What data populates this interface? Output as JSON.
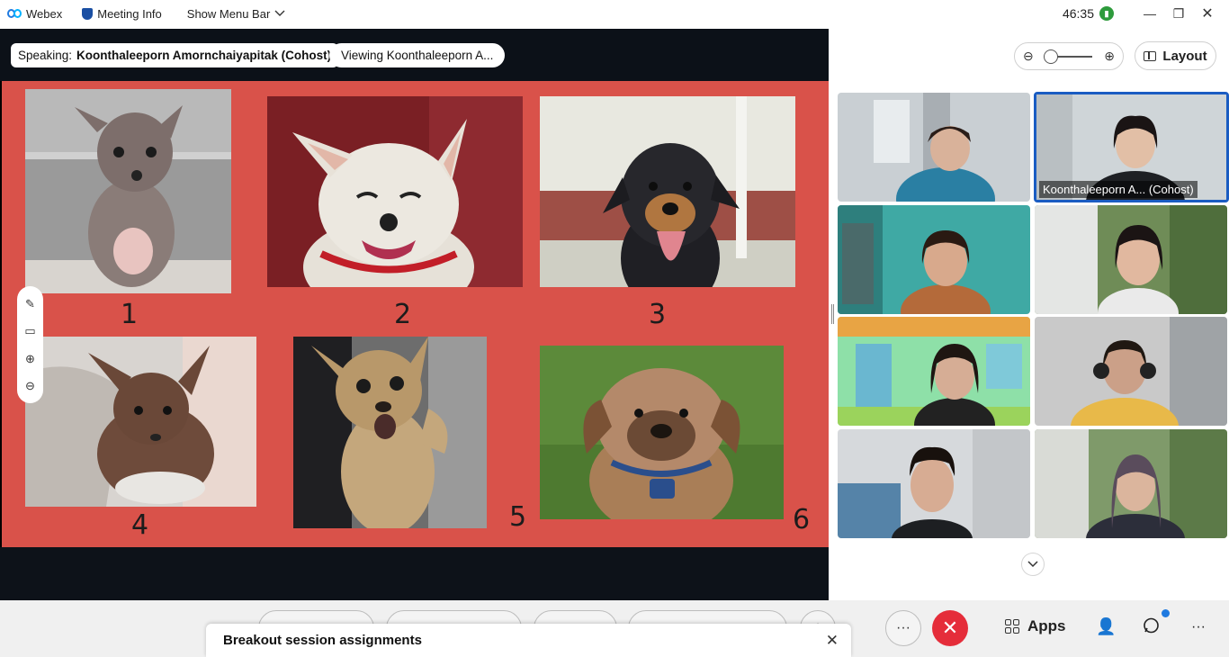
{
  "titlebar": {
    "app_name": "Webex",
    "meeting_info": "Meeting Info",
    "show_menu_bar": "Show Menu Bar",
    "timer": "46:35",
    "window_controls": {
      "minimize": "—",
      "restore": "❐",
      "close": "✕"
    }
  },
  "share": {
    "speaking_label": "Speaking:",
    "speaking_name": "Koonthaleeporn Amornchaiyapitak (Cohost)",
    "viewing_label": "Viewing Koonthaleeporn A...",
    "dog_numbers": [
      "1",
      "2",
      "3",
      "4",
      "5",
      "6"
    ],
    "annotation_tools": [
      "pen-icon",
      "screen-icon",
      "zoom-in-icon",
      "zoom-out-icon"
    ]
  },
  "panel": {
    "layout_label": "Layout",
    "zoom_level": 0.0,
    "participants": [
      {
        "name": ""
      },
      {
        "name": "Koonthaleeporn A... (Cohost)"
      },
      {
        "name": ""
      },
      {
        "name": ""
      },
      {
        "name": ""
      },
      {
        "name": ""
      },
      {
        "name": ""
      },
      {
        "name": ""
      }
    ]
  },
  "controls": {
    "apps_label": "Apps",
    "more_label": "···",
    "end_icon": "✕"
  },
  "breakout": {
    "title": "Breakout session assignments",
    "close": "✕"
  },
  "colors": {
    "slide_bg": "#d9524a",
    "accent": "#1a5cc2",
    "end_call": "#e52d3a"
  }
}
